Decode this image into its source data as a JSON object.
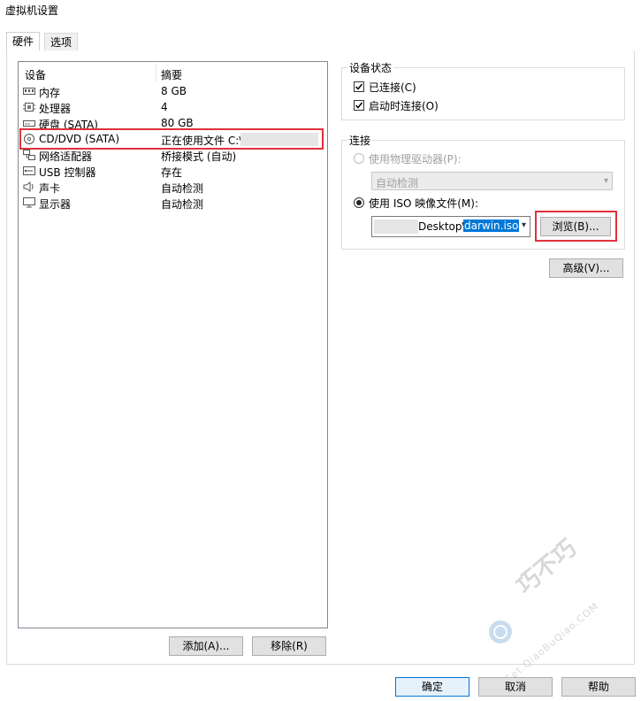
{
  "window": {
    "title": "虚拟机设置"
  },
  "tabs": [
    {
      "label": "硬件"
    },
    {
      "label": "选项"
    }
  ],
  "device_list": {
    "headers": {
      "device": "设备",
      "summary": "摘要"
    },
    "rows": [
      {
        "name": "内存",
        "summary": "8 GB",
        "icon": "memory-icon"
      },
      {
        "name": "处理器",
        "summary": "4",
        "icon": "cpu-icon"
      },
      {
        "name": "硬盘 (SATA)",
        "summary": "80 GB",
        "icon": "hard-disk-icon"
      },
      {
        "name": "CD/DVD (SATA)",
        "summary": "正在使用文件 C:\\",
        "icon": "cd-dvd-icon"
      },
      {
        "name": "网络适配器",
        "summary": "桥接模式 (自动)",
        "icon": "network-adapter-icon"
      },
      {
        "name": "USB 控制器",
        "summary": "存在",
        "icon": "usb-icon"
      },
      {
        "name": "声卡",
        "summary": "自动检测",
        "icon": "speaker-icon"
      },
      {
        "name": "显示器",
        "summary": "自动检测",
        "icon": "monitor-icon"
      }
    ]
  },
  "device_buttons": {
    "add": "添加(A)...",
    "remove": "移除(R)"
  },
  "device_status": {
    "label": "设备状态",
    "connected": "已连接(C)",
    "connect_on_power": "启动时连接(O)"
  },
  "connection": {
    "label": "连接",
    "physical_drive": "使用物理驱动器(P):",
    "physical_drive_value": "自动检测",
    "iso_option": "使用 ISO 映像文件(M):",
    "iso_path_prefix": "Desktop\\",
    "iso_path_file": "darwin.iso",
    "browse": "浏览(B)...",
    "advanced": "高级(V)..."
  },
  "footer": {
    "ok": "确定",
    "cancel": "取消",
    "help": "帮助"
  },
  "watermark": {
    "text": "巧不巧",
    "url": "Get.QiaoBuQiao.COM"
  },
  "colors": {
    "highlight_red": "#e0313a",
    "selection_blue": "#0078d7"
  }
}
